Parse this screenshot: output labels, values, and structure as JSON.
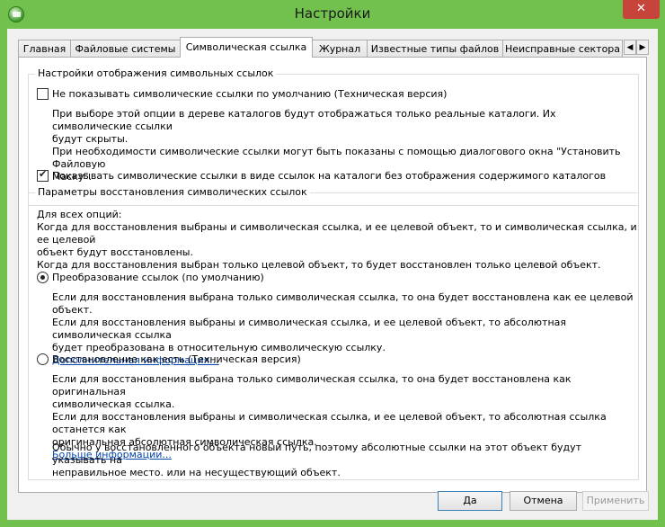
{
  "window": {
    "title": "Настройки",
    "close_label": "✕"
  },
  "tabs": [
    {
      "label": "Главная"
    },
    {
      "label": "Файловые системы"
    },
    {
      "label": "Символическая ссылка",
      "active": true
    },
    {
      "label": "Журнал"
    },
    {
      "label": "Известные типы файлов"
    },
    {
      "label": "Неисправные сектора"
    }
  ],
  "tab_scroll": {
    "left": "◀",
    "right": "▶"
  },
  "display_group": {
    "title": "Настройки отображения символьных ссылок",
    "hide_option": {
      "label": "Не показывать символические ссылки по умолчанию (Техническая версия)",
      "checked": false,
      "desc": [
        "При выборе этой опции в дереве каталогов будут отображаться только реальные каталоги. Их символические ссылки",
        "будут скрыты.",
        "При необходимости символические ссылки могут быть показаны с помощью диалогового окна \"Установить Файловую",
        "Маску\"."
      ]
    },
    "show_option": {
      "label": "Показывать символические ссылки в виде ссылок на каталоги без отображения содержимого каталогов",
      "checked": true
    }
  },
  "restore_group": {
    "title": "Параметры восстановления символических ссылок",
    "intro": [
      "Для всех опций:",
      "Когда для восстановления выбраны и символическая ссылка, и ее целевой объект, то и символическая ссылка, и ее целевой",
      "объект будут восстановлены.",
      "Когда для восстановления выбран только целевой объект, то будет восстановлен только целевой объект."
    ],
    "convert_option": {
      "label": "Преобразование ссылок (по умолчанию)",
      "selected": true,
      "desc": [
        "Если для восстановления выбрана только символическая ссылка, то она будет восстановлена как ее целевой объект.",
        "Если для восстановления выбраны и символическая ссылка, и ее целевой объект, то абсолютная символическая ссылка",
        "будет преобразована в относительную символическую ссылку."
      ],
      "link": "Дополнительная информация..."
    },
    "asis_option": {
      "label": "Восстановление как есть (Техническая версия)",
      "selected": false,
      "desc": [
        "Если для восстановления выбрана только символическая ссылка, то она будет восстановлена как оригинальная",
        "символическая ссылка.",
        "Если для восстановления выбраны и символическая ссылка, и ее целевой объект, то абсолютная ссылка останется как",
        "оригинальная абсолютная символическая ссылка."
      ],
      "link": "Больше информации...",
      "note": [
        "Обычно у восстановленного объекта новый путь, поэтому абсолютные ссылки на этот объект будут указывать на",
        "неправильное место. или на несуществующий объект."
      ]
    }
  },
  "buttons": {
    "ok": "Да",
    "cancel": "Отмена",
    "apply": "Применить"
  }
}
